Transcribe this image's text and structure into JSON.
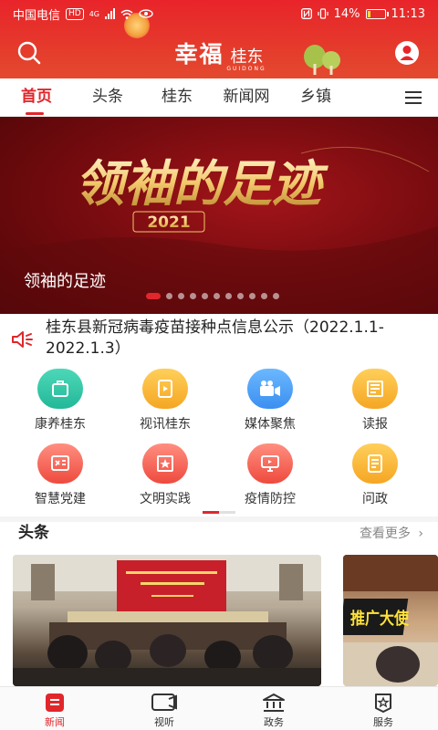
{
  "status_bar": {
    "carrier": "中国电信",
    "hd_badge": "HD",
    "network": "4G",
    "battery": "14%",
    "battery_level": 0.14,
    "time": "11:13"
  },
  "header": {
    "logo_main": "幸福",
    "logo_sub": "桂东",
    "logo_pinyin": "GUIDONG"
  },
  "nav_tabs": [
    {
      "label": "首页",
      "active": true
    },
    {
      "label": "头条",
      "active": false
    },
    {
      "label": "桂东",
      "active": false
    },
    {
      "label": "新闻网",
      "active": false
    },
    {
      "label": "乡镇",
      "active": false
    }
  ],
  "banner": {
    "art_title": "领袖的足迹",
    "art_year": "2021",
    "caption": "领袖的足迹",
    "slide_count": 11,
    "active_slide": 0
  },
  "notice": {
    "text": "桂东县新冠病毒疫苗接种点信息公示（2022.1.1-2022.1.3）"
  },
  "services": [
    {
      "label": "康养桂东",
      "icon": "luggage-icon",
      "color": "teal"
    },
    {
      "label": "视讯桂东",
      "icon": "document-play-icon",
      "color": "orange"
    },
    {
      "label": "媒体聚焦",
      "icon": "video-camera-icon",
      "color": "blue"
    },
    {
      "label": "读报",
      "icon": "newspaper-icon",
      "color": "orange"
    },
    {
      "label": "智慧党建",
      "icon": "party-emblem-icon",
      "color": "red"
    },
    {
      "label": "文明实践",
      "icon": "star-flag-icon",
      "color": "red"
    },
    {
      "label": "疫情防控",
      "icon": "monitor-icon",
      "color": "red"
    },
    {
      "label": "问政",
      "icon": "notepad-icon",
      "color": "orange"
    }
  ],
  "headlines": {
    "title": "头条",
    "more": "查看更多",
    "card2_overlay": "推广大使"
  },
  "bottom_nav": [
    {
      "label": "新闻",
      "icon": "news-icon",
      "active": true
    },
    {
      "label": "视听",
      "icon": "tv-icon",
      "active": false
    },
    {
      "label": "政务",
      "icon": "government-building-icon",
      "active": false
    },
    {
      "label": "服务",
      "icon": "service-badge-icon",
      "active": false
    }
  ],
  "colors": {
    "brand_red": "#e0272b",
    "header_red": "#e8242a"
  }
}
